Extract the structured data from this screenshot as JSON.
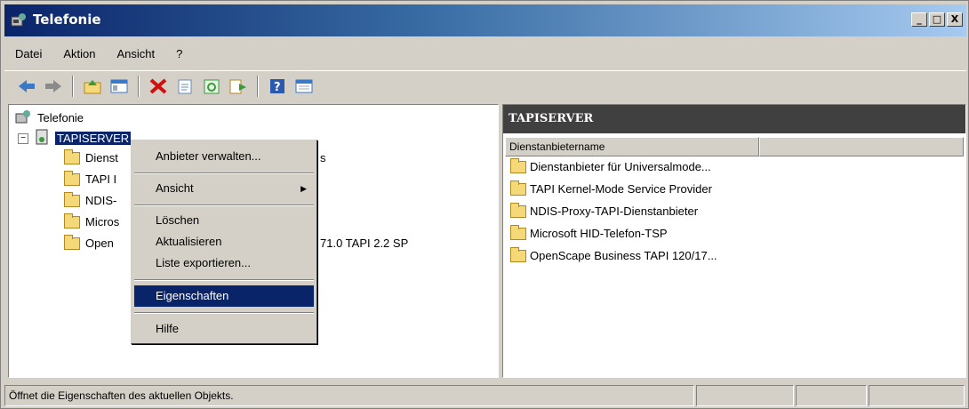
{
  "window": {
    "title": "Telefonie",
    "buttons": {
      "minimize": "_",
      "maximize": "□",
      "close": "X"
    }
  },
  "menubar": {
    "items": [
      "Datei",
      "Aktion",
      "Ansicht",
      "?"
    ]
  },
  "toolbar": {
    "icons": [
      "back-arrow-icon",
      "forward-arrow-icon",
      "up-folder-icon",
      "show-hide-tree-icon",
      "delete-icon",
      "properties-icon",
      "refresh-icon",
      "export-list-icon",
      "help-icon",
      "view-icon"
    ]
  },
  "tree": {
    "root": "Telefonie",
    "server": "TAPISERVER",
    "children": [
      "Dienst",
      "TAPI I",
      "NDIS-",
      "Micros",
      "Open"
    ],
    "overflow_texts": [
      "s",
      "71.0 TAPI 2.2 SP"
    ]
  },
  "context_menu": {
    "items": [
      {
        "label": "Anbieter verwalten..."
      },
      {
        "label": "Ansicht",
        "submenu_arrow": "▶"
      },
      {
        "label": "Löschen"
      },
      {
        "label": "Aktualisieren"
      },
      {
        "label": "Liste exportieren..."
      },
      {
        "label": "Eigenschaften",
        "selected": true
      },
      {
        "label": "Hilfe"
      }
    ]
  },
  "right_pane": {
    "header": "TAPISERVER",
    "column": "Dienstanbietername",
    "items": [
      "Dienstanbieter für Universalmode...",
      "TAPI Kernel-Mode Service Provider",
      "NDIS-Proxy-TAPI-Dienstanbieter",
      "Microsoft HID-Telefon-TSP",
      "OpenScape Business TAPI 120/17..."
    ]
  },
  "statusbar": {
    "text": "Öffnet die Eigenschaften des aktuellen Objekts."
  },
  "colors": {
    "title_start": "#0a246a",
    "title_end": "#a6caf0",
    "selection": "#0a246a",
    "pane_header": "#404040"
  }
}
